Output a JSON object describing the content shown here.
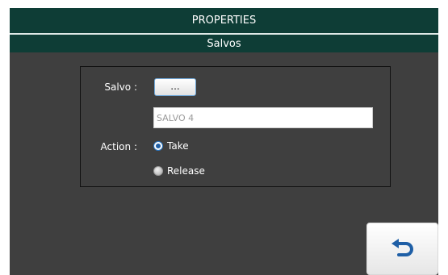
{
  "header": {
    "title": "PROPERTIES",
    "subtitle": "Salvos"
  },
  "form": {
    "salvo_label": "Salvo :",
    "browse_button_label": "...",
    "salvo_value": "SALVO 4",
    "action_label": "Action :",
    "action_options": [
      {
        "label": "Take",
        "selected": true
      },
      {
        "label": "Release",
        "selected": false
      }
    ]
  },
  "footer": {
    "back_icon": "undo-arrow-icon"
  },
  "colors": {
    "header_bg": "#0e3d36",
    "panel_bg": "#3f3f3f",
    "accent_blue": "#1f5fa6"
  }
}
